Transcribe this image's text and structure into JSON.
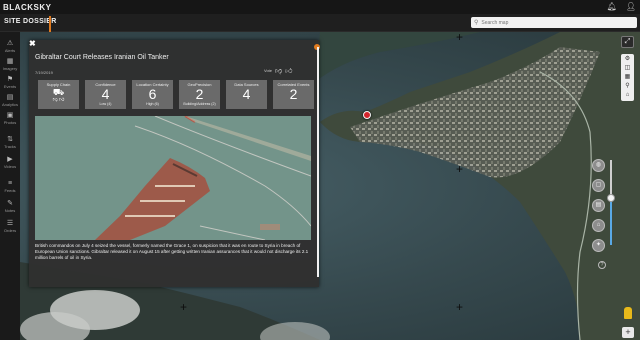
{
  "header": {
    "logo": "BLACKSKY",
    "page_title": "SITE DOSSIER",
    "search_placeholder": "Search map",
    "icons": [
      "bell-icon",
      "user-icon"
    ]
  },
  "sidebar": {
    "items": [
      {
        "label": "Alerts",
        "icon": "alert-icon",
        "glyph": "⚠"
      },
      {
        "label": "Imagery",
        "icon": "imagery-icon",
        "glyph": "▦"
      },
      {
        "label": "Events",
        "icon": "events-icon",
        "glyph": "⚑"
      },
      {
        "label": "Analytics",
        "icon": "analytics-icon",
        "glyph": "▤"
      },
      {
        "label": "Photos",
        "icon": "photos-icon",
        "glyph": "▣"
      },
      {
        "label": "Tracks",
        "icon": "tracks-icon",
        "glyph": "⇅"
      },
      {
        "label": "Videos",
        "icon": "videos-icon",
        "glyph": "▶"
      },
      {
        "label": "Feeds",
        "icon": "feeds-icon",
        "glyph": "≡"
      },
      {
        "label": "Notes",
        "icon": "notes-icon",
        "glyph": "✎"
      },
      {
        "label": "Orders",
        "icon": "orders-icon",
        "glyph": "☰"
      }
    ]
  },
  "dossier": {
    "title": "Gibraltar Court Releases Iranian Oil Tanker",
    "date": "7/19/2019",
    "vote_label": "Vote",
    "cards": [
      {
        "title": "Supply Chain",
        "number": "",
        "sub": "",
        "icon": "truck-icon"
      },
      {
        "title": "Confidence",
        "number": "4",
        "sub": "Low (4)"
      },
      {
        "title": "Location Certainty",
        "number": "6",
        "sub": "High (6)"
      },
      {
        "title": "GeoPrecision",
        "number": "2",
        "sub": "Building/Address (2)"
      },
      {
        "title": "Data Sources",
        "number": "4",
        "sub": ""
      },
      {
        "title": "Correlated Events",
        "number": "2",
        "sub": ""
      }
    ],
    "description": "British commandos on July 4 seized the vessel, formerly named the Grace 1, on suspicion that it was en route to Syria in breach of European Union sanctions. Gibraltar released it on August 15 after getting written Iranian assurances that it would not discharge its 2.1 million barrels of oil in Syria."
  },
  "map_tools": [
    "expand-icon",
    "gear-icon",
    "layers-icon",
    "grid-icon",
    "pin-icon",
    "home-icon"
  ],
  "zoom": {
    "buttons": [
      "zoom-level-1",
      "zoom-level-2",
      "zoom-level-3",
      "zoom-level-4",
      "zoom-level-5"
    ],
    "level_fraction": 0.55
  },
  "colors": {
    "accent": "#e07a1f",
    "pin": "#d4242c",
    "slider": "#5aa9e6"
  }
}
